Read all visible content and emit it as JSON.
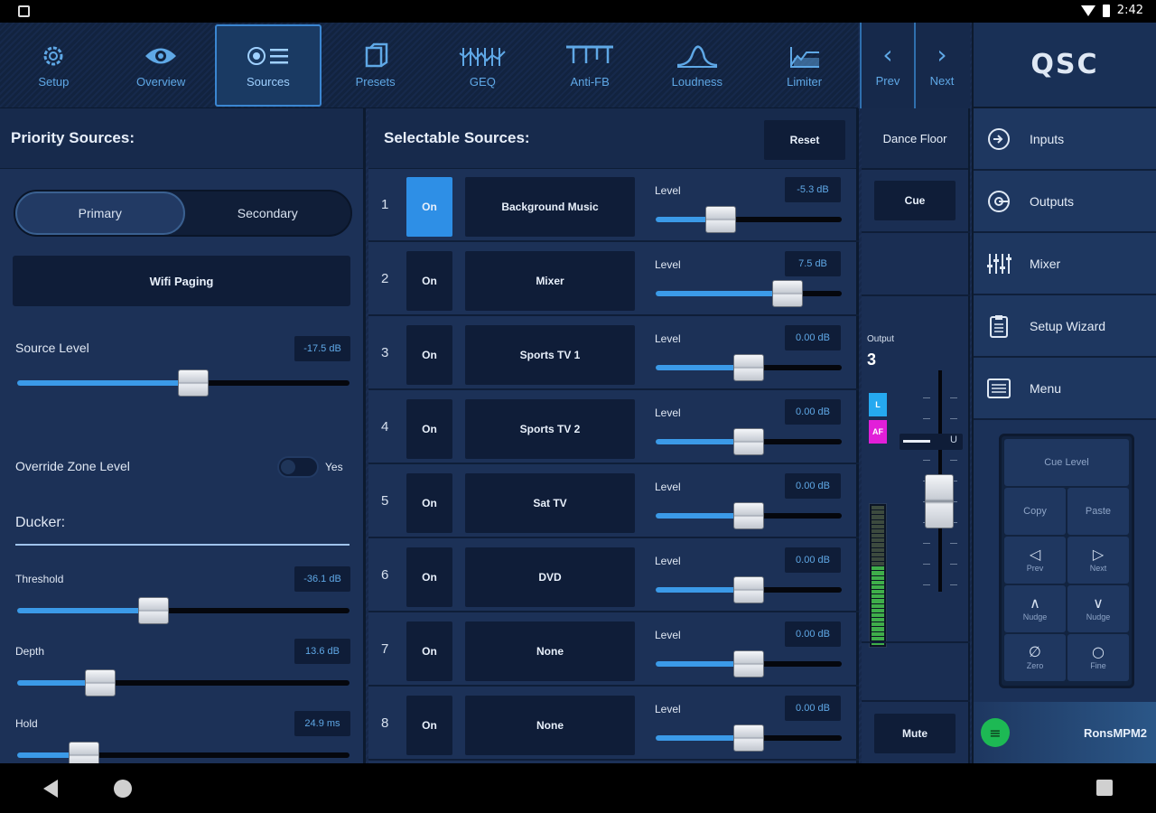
{
  "status_bar": {
    "time": "2:42"
  },
  "nav": {
    "tabs": [
      {
        "label": "Setup",
        "icon": "gear-icon"
      },
      {
        "label": "Overview",
        "icon": "eye-icon"
      },
      {
        "label": "Sources",
        "icon": "sources-list-icon",
        "active": true
      },
      {
        "label": "Presets",
        "icon": "presets-icon"
      },
      {
        "label": "GEQ",
        "icon": "geq-icon"
      },
      {
        "label": "Anti-FB",
        "icon": "anti-feedback-icon"
      },
      {
        "label": "Loudness",
        "icon": "loudness-curve-icon"
      },
      {
        "label": "Limiter",
        "icon": "limiter-icon"
      }
    ],
    "prev": "Prev",
    "next": "Next"
  },
  "brand": "QSC",
  "right_menu": [
    {
      "label": "Inputs",
      "icon": "inputs-icon"
    },
    {
      "label": "Outputs",
      "icon": "outputs-icon"
    },
    {
      "label": "Mixer",
      "icon": "mixer-icon"
    },
    {
      "label": "Setup Wizard",
      "icon": "clipboard-icon"
    },
    {
      "label": "Menu",
      "icon": "menu-list-icon"
    }
  ],
  "keypad": {
    "cue_level": "Cue Level",
    "copy": "Copy",
    "paste": "Paste",
    "prev": "Prev",
    "next": "Next",
    "nudge_up": "Nudge",
    "nudge_down": "Nudge",
    "zero": "Zero",
    "fine": "Fine"
  },
  "now_playing": {
    "name": "RonsMPM2"
  },
  "priority": {
    "title": "Priority Sources:",
    "primary": "Primary",
    "secondary": "Secondary",
    "selected_source": "Wifi Paging",
    "source_level_label": "Source Level",
    "source_level_value": "-17.5 dB",
    "source_level_pos": 0.53,
    "override_label": "Override Zone Level",
    "override_state": "Yes",
    "ducker_label": "Ducker:",
    "threshold_label": "Threshold",
    "threshold_value": "-36.1 dB",
    "threshold_pos": 0.41,
    "depth_label": "Depth",
    "depth_value": "13.6 dB",
    "depth_pos": 0.25,
    "hold_label": "Hold",
    "hold_value": "24.9 ms",
    "hold_pos": 0.2
  },
  "selectable": {
    "title": "Selectable Sources:",
    "reset": "Reset",
    "level_label": "Level",
    "on_label": "On",
    "rows": [
      {
        "num": "1",
        "name": "Background Music",
        "value": "-5.3 dB",
        "pos": 0.35,
        "active": true
      },
      {
        "num": "2",
        "name": "Mixer",
        "value": "7.5 dB",
        "pos": 0.71,
        "active": false
      },
      {
        "num": "3",
        "name": "Sports TV 1",
        "value": "0.00 dB",
        "pos": 0.5,
        "active": false
      },
      {
        "num": "4",
        "name": "Sports TV 2",
        "value": "0.00 dB",
        "pos": 0.5,
        "active": false
      },
      {
        "num": "5",
        "name": "Sat TV",
        "value": "0.00 dB",
        "pos": 0.5,
        "active": false
      },
      {
        "num": "6",
        "name": "DVD",
        "value": "0.00 dB",
        "pos": 0.5,
        "active": false
      },
      {
        "num": "7",
        "name": "None",
        "value": "0.00 dB",
        "pos": 0.5,
        "active": false
      },
      {
        "num": "8",
        "name": "None",
        "value": "0.00 dB",
        "pos": 0.5,
        "active": false
      }
    ]
  },
  "zone": {
    "name": "Dance Floor",
    "cue": "Cue",
    "output_label": "Output",
    "output_num": "3",
    "badge_l": "L",
    "badge_af": "AF",
    "mute": "Mute",
    "pan_value": "U",
    "meter_level": 0.55
  },
  "colors": {
    "accent": "#3b9ae8",
    "active_on": "#2e8fe6",
    "badge_l": "#25a9f0",
    "badge_af": "#e21fd9",
    "meter_green": "#3fae4a",
    "spotify": "#1db954"
  }
}
